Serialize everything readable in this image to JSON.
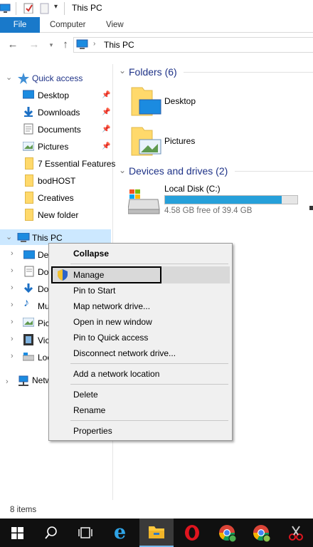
{
  "window": {
    "title": "This PC"
  },
  "ribbon": {
    "tabs": [
      "File",
      "Computer",
      "View"
    ]
  },
  "address": {
    "path": "This PC"
  },
  "nav_pane": {
    "quick_access_label": "Quick access",
    "quick_items": [
      {
        "label": "Desktop",
        "pinned": true
      },
      {
        "label": "Downloads",
        "pinned": true
      },
      {
        "label": "Documents",
        "pinned": true
      },
      {
        "label": "Pictures",
        "pinned": true
      },
      {
        "label": "7 Essential Features",
        "pinned": false
      },
      {
        "label": "bodHOST",
        "pinned": false
      },
      {
        "label": "Creatives",
        "pinned": false
      },
      {
        "label": "New folder",
        "pinned": false
      }
    ],
    "this_pc_label": "This PC",
    "this_pc_children": [
      "De",
      "Do",
      "Do",
      "Mu",
      "Pic",
      "Vic",
      "Loc"
    ],
    "network_label": "Netw"
  },
  "content": {
    "folders_header": "Folders (6)",
    "folders": [
      "Desktop",
      "Pictures"
    ],
    "devices_header": "Devices and drives (2)",
    "drive": {
      "name": "Local Disk (C:)",
      "free_text": "4.58 GB free of 39.4 GB",
      "used_fraction": 0.884
    }
  },
  "context_menu": {
    "items": [
      {
        "label": "Collapse",
        "bold": true
      },
      {
        "label": "Manage",
        "highlighted": true
      },
      {
        "label": "Pin to Start"
      },
      {
        "label": "Map network drive..."
      },
      {
        "label": "Open in new window"
      },
      {
        "label": "Pin to Quick access"
      },
      {
        "label": "Disconnect network drive..."
      },
      {
        "label": "Add a network location"
      },
      {
        "label": "Delete"
      },
      {
        "label": "Rename"
      },
      {
        "label": "Properties"
      }
    ]
  },
  "status_bar": {
    "item_count": "8 items"
  },
  "colors": {
    "accent": "#1979ca",
    "selection": "#cce8ff",
    "drive_fill": "#26a0da",
    "header": "#1e3287"
  }
}
